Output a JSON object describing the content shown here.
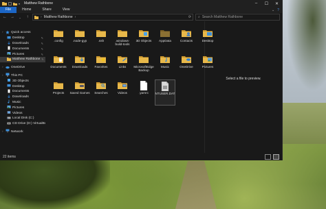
{
  "window": {
    "title": "Matthew Rathbone",
    "controls": [
      "minimize-icon",
      "maximize-icon",
      "close-icon"
    ]
  },
  "ribbon": {
    "tabs": [
      "File",
      "Home",
      "Share",
      "View"
    ]
  },
  "address": {
    "crumbs": [
      "Matthew Rathbone"
    ],
    "search_placeholder": "Search Matthew Rathbone"
  },
  "nav": {
    "items": [
      {
        "label": "Quick access",
        "icon": "star-icon",
        "level": 1,
        "pinned": false
      },
      {
        "label": "Desktop",
        "icon": "desktop-folder-icon",
        "level": 2,
        "pinned": true
      },
      {
        "label": "Downloads",
        "icon": "downloads-folder-icon",
        "level": 2,
        "pinned": true
      },
      {
        "label": "Documents",
        "icon": "documents-folder-icon",
        "level": 2,
        "pinned": true
      },
      {
        "label": "Pictures",
        "icon": "pictures-folder-icon",
        "level": 2,
        "pinned": true
      },
      {
        "label": "Matthew Rathbone",
        "icon": "user-folder-icon",
        "level": 2,
        "pinned": true,
        "selected": true
      },
      {
        "label": "",
        "gap": true
      },
      {
        "label": "OneDrive",
        "icon": "cloud-icon",
        "level": 1
      },
      {
        "label": "",
        "gap": true
      },
      {
        "label": "This PC",
        "icon": "computer-icon",
        "level": 1
      },
      {
        "label": "3D Objects",
        "icon": "3d-objects-icon",
        "level": 2
      },
      {
        "label": "Desktop",
        "icon": "desktop-folder-icon",
        "level": 2
      },
      {
        "label": "Documents",
        "icon": "documents-folder-icon",
        "level": 2
      },
      {
        "label": "Downloads",
        "icon": "downloads-folder-icon",
        "level": 2
      },
      {
        "label": "Music",
        "icon": "music-folder-icon",
        "level": 2
      },
      {
        "label": "Pictures",
        "icon": "pictures-folder-icon",
        "level": 2
      },
      {
        "label": "Videos",
        "icon": "videos-folder-icon",
        "level": 2
      },
      {
        "label": "Local Disk (C:)",
        "icon": "drive-icon",
        "level": 2
      },
      {
        "label": "CD Drive (D:) VirtualBox",
        "icon": "cd-drive-icon",
        "level": 2
      },
      {
        "label": "",
        "gap": true
      },
      {
        "label": "Network",
        "icon": "network-icon",
        "level": 1
      }
    ]
  },
  "files": [
    {
      "label": ".config",
      "icon": "folder-icon",
      "badge": ""
    },
    {
      "label": ".node-gyp",
      "icon": "folder-icon",
      "badge": ""
    },
    {
      "label": ".ssh",
      "icon": "folder-icon",
      "badge": ""
    },
    {
      "label": ".windows-build-tools",
      "icon": "folder-icon",
      "badge": ""
    },
    {
      "label": "3D Objects",
      "icon": "3d-objects-folder-icon",
      "badge": "cube"
    },
    {
      "label": "AppData",
      "icon": "folder-icon",
      "badge": "",
      "dim": true
    },
    {
      "label": "Contacts",
      "icon": "contacts-folder-icon",
      "badge": "contact"
    },
    {
      "label": "Desktop",
      "icon": "desktop-folder-icon",
      "badge": "desktop"
    },
    {
      "label": "",
      "icon": "",
      "empty": true
    },
    {
      "label": "Documents",
      "icon": "documents-folder-icon",
      "badge": "doc"
    },
    {
      "label": "Downloads",
      "icon": "downloads-folder-icon",
      "badge": "down"
    },
    {
      "label": "Favorites",
      "icon": "favorites-folder-icon",
      "badge": "star"
    },
    {
      "label": "Links",
      "icon": "links-folder-icon",
      "badge": "link"
    },
    {
      "label": "MicrosoftEdgeBackup",
      "icon": "folder-icon",
      "badge": ""
    },
    {
      "label": "Music",
      "icon": "music-folder-icon",
      "badge": "music"
    },
    {
      "label": "OneDrive",
      "icon": "onedrive-folder-icon",
      "badge": "cloud"
    },
    {
      "label": "Pictures",
      "icon": "pictures-folder-icon",
      "badge": "pic"
    },
    {
      "label": "",
      "icon": "",
      "empty": true
    },
    {
      "label": "Projects",
      "icon": "folder-icon",
      "badge": ""
    },
    {
      "label": "Saved Games",
      "icon": "saved-games-folder-icon",
      "badge": "game"
    },
    {
      "label": "Searches",
      "icon": "searches-folder-icon",
      "badge": "search"
    },
    {
      "label": "Videos",
      "icon": "videos-folder-icon",
      "badge": "video"
    },
    {
      "label": ".yarnrc",
      "icon": "file-icon",
      "badge": ""
    },
    {
      "label": "NTUSER.DAT",
      "icon": "system-file-icon",
      "badge": "",
      "selected": true
    }
  ],
  "preview": {
    "message": "Select a file to preview."
  },
  "status": {
    "count": "22 items"
  },
  "colors": {
    "folder": "#e8b84a",
    "folder_dark": "#c9952c",
    "accent": "#1c66c6",
    "bg": "#191919"
  }
}
